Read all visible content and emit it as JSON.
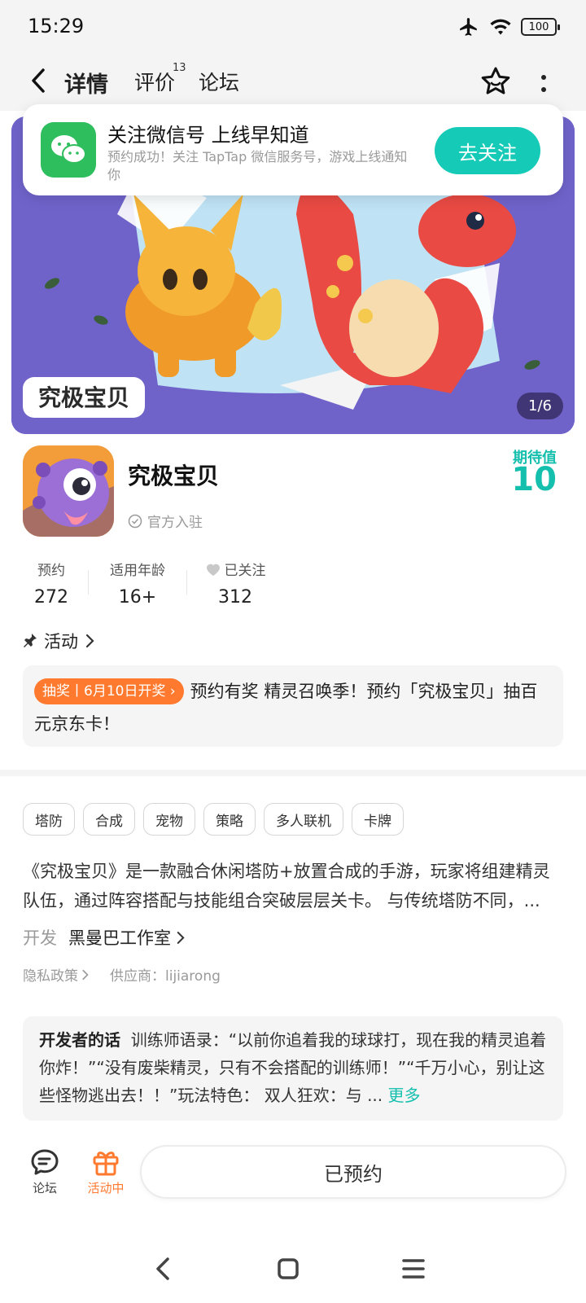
{
  "status_bar": {
    "time": "15:29",
    "battery": "100"
  },
  "nav": {
    "tabs": [
      {
        "label": "详情"
      },
      {
        "label": "评价",
        "badge": "13"
      },
      {
        "label": "论坛"
      }
    ]
  },
  "wechat_card": {
    "title": "关注微信号 上线早知道",
    "description": "预约成功！关注 TapTap 微信服务号，游戏上线通知你",
    "button": "去关注"
  },
  "banner": {
    "indicator": "1/6",
    "logo_text": "究极宝贝"
  },
  "game": {
    "title": "究极宝贝",
    "official_label": "官方入驻",
    "expect_label": "期待值",
    "expect_value": "10"
  },
  "stats": [
    {
      "label": "预约",
      "value": "272"
    },
    {
      "label": "适用年龄",
      "value": "16+"
    },
    {
      "label": "已关注",
      "value": "312"
    }
  ],
  "activity": {
    "header": "活动",
    "tag": "抽奖丨6月10日开奖",
    "text": "预约有奖 精灵召唤季！预约「究极宝贝」抽百元京东卡！"
  },
  "tags": [
    "塔防",
    "合成",
    "宠物",
    "策略",
    "多人联机",
    "卡牌"
  ],
  "description": "《究极宝贝》是一款融合休闲塔防+放置合成的手游，玩家将组建精灵队伍，通过阵容搭配与技能组合突破层层关卡。 与传统塔防不同，...",
  "developer": {
    "label": "开发",
    "name": "黑曼巴工作室"
  },
  "meta": {
    "privacy": "隐私政策",
    "supplier": "供应商：lijiarong"
  },
  "developer_note": {
    "title": "开发者的话",
    "text": "训练师语录：“以前你追着我的球球打，现在我的精灵追着你炸！”“没有废柴精灵，只有不会搭配的训练师！”“千万小心，别让这些怪物逃出去！！”玩法特色： 双人狂欢：与 ...",
    "more": "更多"
  },
  "action_bar": {
    "forum": "论坛",
    "event": "活动中",
    "reserved": "已预约"
  },
  "colors": {
    "accent": "#15cbb8",
    "orange": "#ff7a2e",
    "wechat": "#2ebe5e"
  }
}
